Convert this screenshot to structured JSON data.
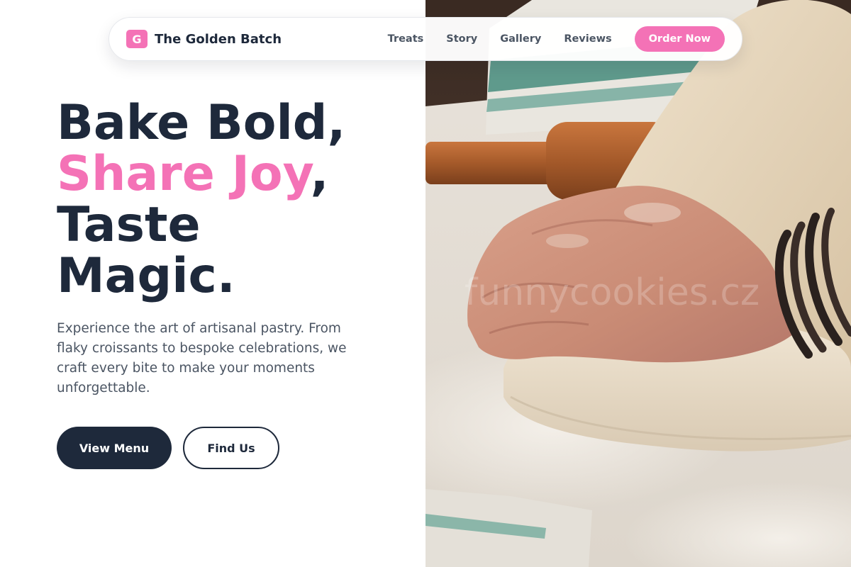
{
  "brand": {
    "logo_letter": "G",
    "name": "The Golden Batch"
  },
  "nav": {
    "links": [
      "Treats",
      "Story",
      "Gallery",
      "Reviews"
    ],
    "cta_label": "Order Now"
  },
  "hero": {
    "headline_line1": "Bake Bold,",
    "headline_line2_accent": "Share Joy",
    "headline_line2_rest": ",",
    "headline_line3": "Taste",
    "headline_line4": "Magic.",
    "tagline": "Experience the art of artisanal pastry. From flaky croissants to bespoke celebrations, we craft every bite to make your moments unforgettable.",
    "primary_button": "View Menu",
    "secondary_button": "Find Us",
    "photo_watermark": "funnycookies.cz"
  },
  "colors": {
    "accent_pink": "#f472b6",
    "navy": "#1e293b",
    "body_text": "#4b5563",
    "background": "#ffffff"
  },
  "icons": {
    "hero_photo": "baker-kneading-dough-photo"
  }
}
